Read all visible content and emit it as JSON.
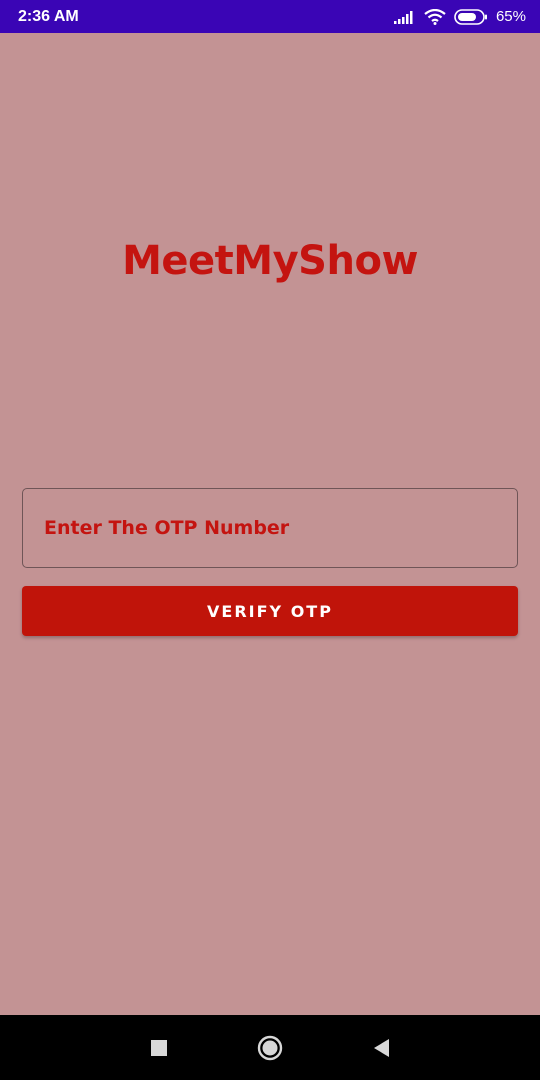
{
  "status_bar": {
    "time": "2:36 AM",
    "battery": "65%",
    "icons": [
      "signal-icon",
      "wifi-icon",
      "battery-icon"
    ]
  },
  "app": {
    "title": "MeetMyShow"
  },
  "otp": {
    "placeholder": "Enter The OTP Number",
    "value": ""
  },
  "verify_button": {
    "label": "VERIFY OTP"
  },
  "nav_bar": {
    "icons": [
      "recent-apps-icon",
      "home-icon",
      "back-icon"
    ]
  },
  "colors": {
    "background": "#c39394",
    "status_bar": "#3a05b5",
    "accent": "#c41410",
    "button": "#c0140a"
  }
}
